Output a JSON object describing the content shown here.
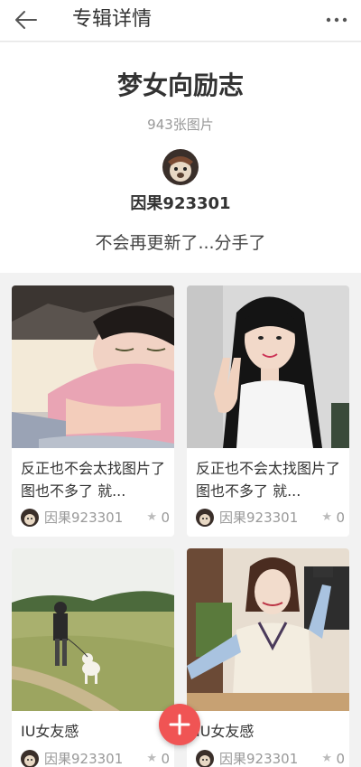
{
  "topbar": {
    "title": "专辑详情",
    "back_icon": "arrow-left-icon",
    "more_icon": "more-dots-icon"
  },
  "album": {
    "title": "梦女向励志",
    "count": "943张图片",
    "author": "因果923301",
    "description": "不会再更新了...分手了"
  },
  "cards": [
    {
      "caption": "反正也不会太找图片了 图也不多了 就...",
      "author": "因果923301",
      "likes": "0"
    },
    {
      "caption": "反正也不会太找图片了 图也不多了 就...",
      "author": "因果923301",
      "likes": "0"
    },
    {
      "caption": "IU女友感",
      "author": "因果923301",
      "likes": "0"
    },
    {
      "caption": "IU女友感",
      "author": "因果923301",
      "likes": "0"
    }
  ],
  "fab": {
    "icon": "plus-icon"
  },
  "colors": {
    "accent": "#f05454",
    "muted": "#999999",
    "background": "#f2f2f2"
  }
}
